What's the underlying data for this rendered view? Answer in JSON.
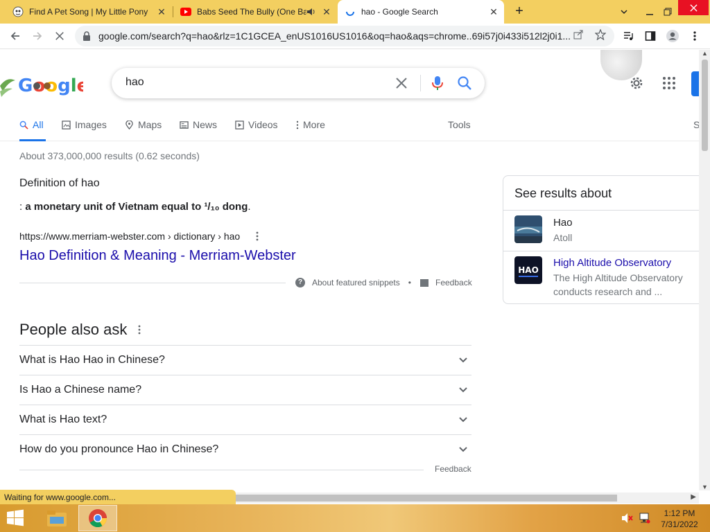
{
  "browser": {
    "tabs": [
      {
        "title": "Find A Pet Song | My Little Pony",
        "close": "✕",
        "active": false
      },
      {
        "title": "Babs Seed The Bully (One Ba",
        "close": "✕",
        "active": false,
        "audio": true
      },
      {
        "title": "hao - Google Search",
        "close": "✕",
        "active": true,
        "loading": true
      }
    ],
    "new_tab": "+",
    "address": "google.com/search?q=hao&rlz=1C1GCEA_enUS1016US1016&oq=hao&aqs=chrome..69i57j0i433i512l2j0i1...",
    "status_text": "Waiting for www.google.com..."
  },
  "google": {
    "logo": "Google",
    "query": "hao",
    "tabs": [
      {
        "label": "All",
        "icon": "search-icon",
        "active": true
      },
      {
        "label": "Images",
        "icon": "image-icon"
      },
      {
        "label": "Maps",
        "icon": "map-pin-icon"
      },
      {
        "label": "News",
        "icon": "news-icon"
      },
      {
        "label": "Videos",
        "icon": "video-icon"
      },
      {
        "label": "More",
        "icon": "kebab-icon"
      }
    ],
    "tools": "Tools",
    "clipped_tab_letter": "S",
    "result_stats": "About 373,000,000 results (0.62 seconds)",
    "definition": {
      "title": "Definition of hao",
      "colon": ":",
      "body": "a monetary unit of Vietnam equal to ¹/₁₀ dong",
      "period": ".",
      "source_url": "https://www.merriam-webster.com › dictionary › hao",
      "link_title": "Hao Definition & Meaning - Merriam-Webster",
      "about_snippets": "About featured snippets",
      "bullet": "•",
      "feedback": "Feedback"
    },
    "people_also_ask": {
      "title": "People also ask",
      "questions": [
        "What is Hao Hao in Chinese?",
        "Is Hao a Chinese name?",
        "What is Hao text?",
        "How do you pronounce Hao in Chinese?"
      ],
      "feedback": "Feedback"
    },
    "see_results_about": {
      "title": "See results about",
      "items": [
        {
          "name": "Hao",
          "sub": "Atoll"
        },
        {
          "name": "High Altitude Observatory",
          "sub": "The High Altitude Observatory conducts research and ...",
          "thumb_text": "HAO"
        }
      ]
    }
  },
  "taskbar": {
    "time": "1:12 PM",
    "date": "7/31/2022"
  },
  "colors": {
    "tabstrip": "#f3cf60",
    "link": "#1a0dab",
    "accent": "#1a73e8"
  }
}
